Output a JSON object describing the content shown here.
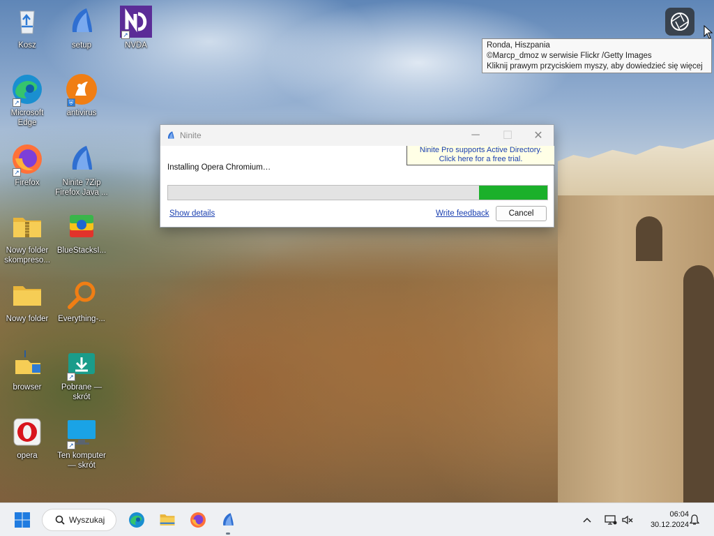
{
  "desktop": {
    "icons": [
      {
        "id": "kosz",
        "label": "Kosz"
      },
      {
        "id": "setup",
        "label": "setup"
      },
      {
        "id": "nvda",
        "label": "NVDA"
      },
      {
        "id": "edge",
        "label": "Microsoft\nEdge"
      },
      {
        "id": "antivirus",
        "label": "antivirus"
      },
      {
        "id": "firefox",
        "label": "Firefox"
      },
      {
        "id": "ninite-multi",
        "label": "Ninite 7Zip\nFirefox Java ..."
      },
      {
        "id": "zip-folder",
        "label": "Nowy folder\nskompreso..."
      },
      {
        "id": "bluestacks",
        "label": "BlueStacksI..."
      },
      {
        "id": "new-folder",
        "label": "Nowy folder"
      },
      {
        "id": "everything",
        "label": "Everything-..."
      },
      {
        "id": "browser",
        "label": "browser"
      },
      {
        "id": "downloads",
        "label": "Pobrane —\nskrót"
      },
      {
        "id": "opera",
        "label": "opera"
      },
      {
        "id": "this-pc",
        "label": "Ten komputer\n— skrót"
      }
    ]
  },
  "tooltip": {
    "line1": "Ronda, Hiszpania",
    "line2": "©Marcp_dmoz w serwisie Flickr /Getty Images",
    "line3": "Kliknij prawym przyciskiem myszy, aby dowiedzieć się więcej"
  },
  "ninite": {
    "title": "Ninite",
    "promo_line1": "Ninite Pro supports Active Directory.",
    "promo_line2": "Click here for a free trial.",
    "status": "Installing Opera Chromium…",
    "progress_fraction": 0.82,
    "show_details": "Show details",
    "write_feedback": "Write feedback",
    "cancel": "Cancel",
    "colors": {
      "progress": "#1bb02a",
      "link": "#1a3fb0"
    }
  },
  "taskbar": {
    "search_label": "Wyszukaj",
    "time": "06:04",
    "date": "30.12.2024"
  }
}
